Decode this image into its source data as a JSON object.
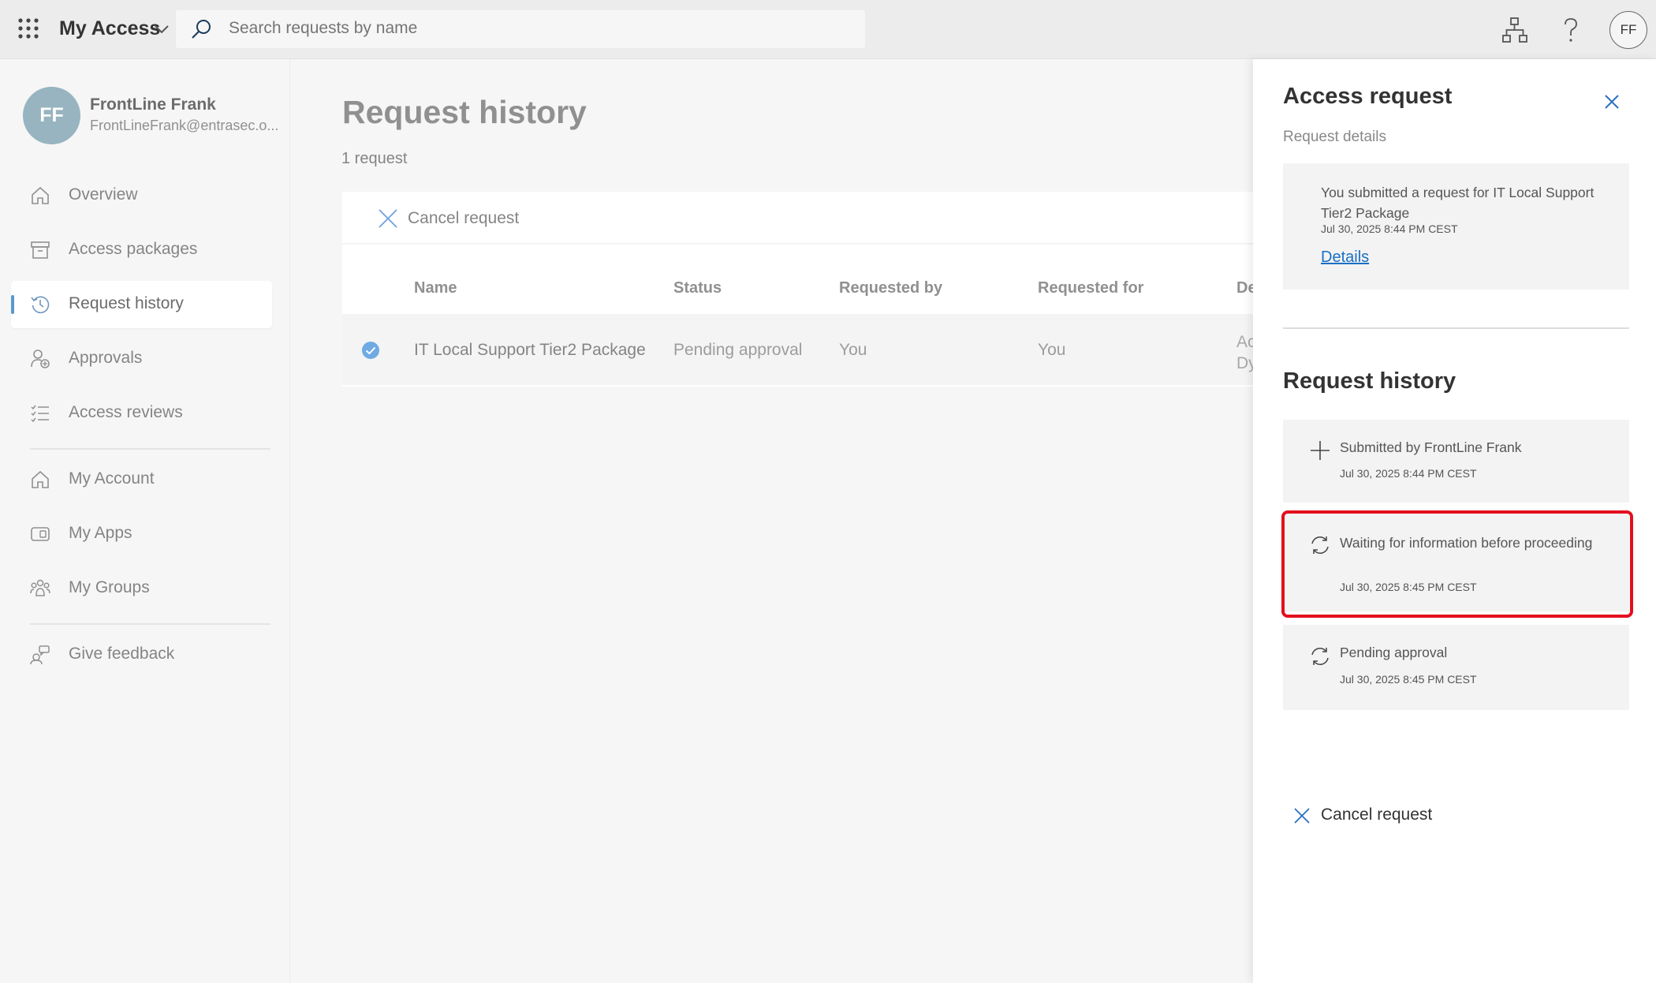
{
  "topbar": {
    "app_title": "My Access",
    "search_placeholder": "Search requests by name",
    "avatar_initials": "FF"
  },
  "sidebar": {
    "user": {
      "initials": "FF",
      "name": "FrontLine Frank",
      "email": "FrontLineFrank@entrasec.o..."
    },
    "items": [
      {
        "label": "Overview",
        "icon": "home-icon"
      },
      {
        "label": "Access packages",
        "icon": "package-icon"
      },
      {
        "label": "Request history",
        "icon": "history-icon",
        "active": true
      },
      {
        "label": "Approvals",
        "icon": "approvals-icon"
      },
      {
        "label": "Access reviews",
        "icon": "checklist-icon"
      },
      {
        "label": "My Account",
        "icon": "home-icon"
      },
      {
        "label": "My Apps",
        "icon": "apps-icon"
      },
      {
        "label": "My Groups",
        "icon": "groups-icon"
      },
      {
        "label": "Give feedback",
        "icon": "feedback-icon"
      }
    ]
  },
  "main": {
    "title": "Request history",
    "count": "1 request",
    "cancel_label": "Cancel request",
    "columns": [
      "Name",
      "Status",
      "Requested by",
      "Requested for",
      "De"
    ],
    "rows": [
      {
        "name": "IT Local Support Tier2 Package",
        "status": "Pending approval",
        "requested_by": "You",
        "requested_for": "You",
        "details_clip_1": "Ac",
        "details_clip_2": "Dy",
        "selected": true
      }
    ]
  },
  "panel": {
    "title": "Access request",
    "subtitle": "Request details",
    "summary": {
      "text": "You submitted a request for IT Local Support Tier2 Package",
      "date": "Jul 30, 2025 8:44 PM CEST",
      "details_link": "Details"
    },
    "history_title": "Request history",
    "history": [
      {
        "label": "Submitted by FrontLine Frank",
        "date": "Jul 30, 2025 8:44 PM CEST",
        "icon": "plus-icon"
      },
      {
        "label": "Waiting for information before proceeding",
        "date": "Jul 30, 2025 8:45 PM CEST",
        "icon": "sync-icon",
        "highlighted": true
      },
      {
        "label": "Pending approval",
        "date": "Jul 30, 2025 8:45 PM CEST",
        "icon": "sync-icon"
      }
    ],
    "cancel_label": "Cancel request"
  },
  "colors": {
    "accent": "#1a73b8",
    "link": "#1a6fc4",
    "highlight": "#e3101e",
    "avatar": "#6f97a8"
  }
}
